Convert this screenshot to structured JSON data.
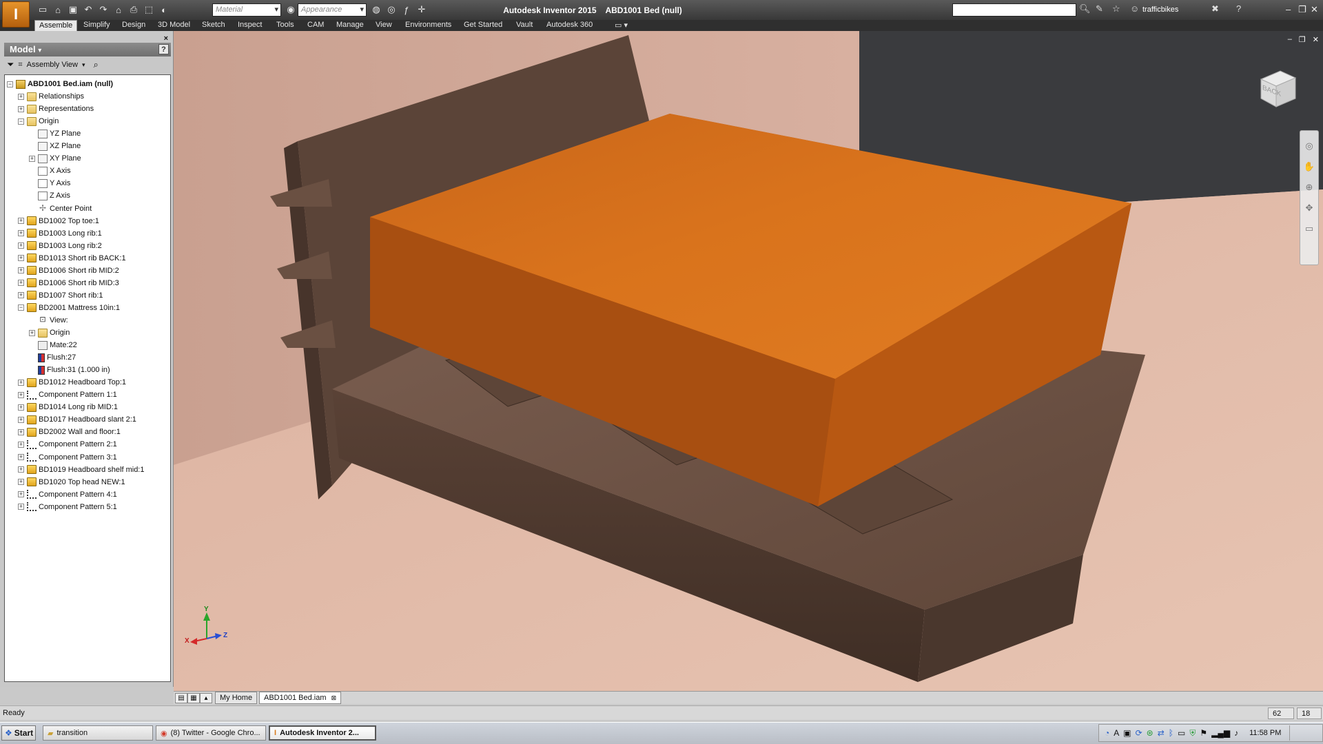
{
  "title_bar": {
    "app_title": "Autodesk Inventor 2015",
    "document_title": "ABD1001 Bed (null)",
    "material_placeholder": "Material",
    "appearance_placeholder": "Appearance",
    "user": "trafficbikes",
    "window_controls": [
      "–",
      "❐",
      "✕"
    ]
  },
  "ribbon": {
    "tabs": [
      "Assemble",
      "Simplify",
      "Design",
      "3D Model",
      "Sketch",
      "Inspect",
      "Tools",
      "CAM",
      "Manage",
      "View",
      "Environments",
      "Get Started",
      "Vault",
      "Autodesk 360"
    ],
    "active_tab": "Assemble"
  },
  "browser": {
    "title": "Model",
    "view_label": "Assembly View",
    "tree": [
      {
        "label": "ABD1001 Bed.iam (null)",
        "icon": "assembly-icon",
        "depth": 0,
        "expander": "−",
        "bold": true
      },
      {
        "label": "Relationships",
        "icon": "folder-icon",
        "depth": 1,
        "expander": "+"
      },
      {
        "label": "Representations",
        "icon": "folder-icon",
        "depth": 1,
        "expander": "+"
      },
      {
        "label": "Origin",
        "icon": "folder-icon",
        "depth": 1,
        "expander": "−"
      },
      {
        "label": "YZ Plane",
        "icon": "plane-icon",
        "depth": 2,
        "expander": ""
      },
      {
        "label": "XZ Plane",
        "icon": "plane-icon",
        "depth": 2,
        "expander": ""
      },
      {
        "label": "XY Plane",
        "icon": "plane-icon",
        "depth": 2,
        "expander": "+"
      },
      {
        "label": "X Axis",
        "icon": "axis-icon",
        "depth": 2,
        "expander": ""
      },
      {
        "label": "Y Axis",
        "icon": "axis-icon",
        "depth": 2,
        "expander": ""
      },
      {
        "label": "Z Axis",
        "icon": "axis-icon",
        "depth": 2,
        "expander": ""
      },
      {
        "label": "Center Point",
        "icon": "point-icon",
        "depth": 2,
        "expander": ""
      },
      {
        "label": "BD1002 Top toe:1",
        "icon": "part-icon",
        "depth": 1,
        "expander": "+"
      },
      {
        "label": "BD1003 Long rib:1",
        "icon": "part-icon",
        "depth": 1,
        "expander": "+"
      },
      {
        "label": "BD1003 Long rib:2",
        "icon": "part-icon",
        "depth": 1,
        "expander": "+"
      },
      {
        "label": "BD1013 Short rib BACK:1",
        "icon": "part-icon",
        "depth": 1,
        "expander": "+"
      },
      {
        "label": "BD1006 Short rib MID:2",
        "icon": "part-icon",
        "depth": 1,
        "expander": "+"
      },
      {
        "label": "BD1006 Short rib MID:3",
        "icon": "part-icon",
        "depth": 1,
        "expander": "+"
      },
      {
        "label": "BD1007 Short rib:1",
        "icon": "part-icon",
        "depth": 1,
        "expander": "+"
      },
      {
        "label": "BD2001 Mattress 10in:1",
        "icon": "part-icon",
        "depth": 1,
        "expander": "−"
      },
      {
        "label": "View:",
        "icon": "view-icon",
        "depth": 2,
        "expander": ""
      },
      {
        "label": "Origin",
        "icon": "folder-icon",
        "depth": 2,
        "expander": "+"
      },
      {
        "label": "Mate:22",
        "icon": "mate-icon",
        "depth": 2,
        "expander": ""
      },
      {
        "label": "Flush:27",
        "icon": "flush-icon",
        "depth": 2,
        "expander": ""
      },
      {
        "label": "Flush:31 (1.000 in)",
        "icon": "flush-icon",
        "depth": 2,
        "expander": ""
      },
      {
        "label": "BD1012 Headboard Top:1",
        "icon": "part-icon",
        "depth": 1,
        "expander": "+"
      },
      {
        "label": "Component Pattern 1:1",
        "icon": "pattern-icon",
        "depth": 1,
        "expander": "+"
      },
      {
        "label": "BD1014 Long rib MID:1",
        "icon": "part-icon",
        "depth": 1,
        "expander": "+"
      },
      {
        "label": "BD1017 Headboard slant 2:1",
        "icon": "part-icon",
        "depth": 1,
        "expander": "+"
      },
      {
        "label": "BD2002 Wall and floor:1",
        "icon": "part-icon",
        "depth": 1,
        "expander": "+"
      },
      {
        "label": "Component Pattern 2:1",
        "icon": "pattern-icon",
        "depth": 1,
        "expander": "+"
      },
      {
        "label": "Component Pattern 3:1",
        "icon": "pattern-icon",
        "depth": 1,
        "expander": "+"
      },
      {
        "label": "BD1019 Headboard shelf mid:1",
        "icon": "part-icon",
        "depth": 1,
        "expander": "+"
      },
      {
        "label": "BD1020 Top head NEW:1",
        "icon": "part-icon",
        "depth": 1,
        "expander": "+"
      },
      {
        "label": "Component Pattern 4:1",
        "icon": "pattern-icon",
        "depth": 1,
        "expander": "+"
      },
      {
        "label": "Component Pattern 5:1",
        "icon": "pattern-icon",
        "depth": 1,
        "expander": "+"
      }
    ]
  },
  "viewport": {
    "viewcube_face": "BACK",
    "axes": {
      "x": "X",
      "y": "Y",
      "z": "Z"
    },
    "colors": {
      "mattress": "#d9731c",
      "wood": "#6b5244",
      "floor": "#e2bca8",
      "wall_left": "#cfa898",
      "wall_dark": "#3a3b3e"
    }
  },
  "doc_tabs": {
    "tabs": [
      "My Home",
      "ABD1001 Bed.iam"
    ],
    "active": "ABD1001 Bed.iam"
  },
  "status_bar": {
    "text": "Ready",
    "count_a": "62",
    "count_b": "18"
  },
  "taskbar": {
    "start_label": "Start",
    "buttons": [
      "transition",
      "(8) Twitter - Google Chro...",
      "Autodesk Inventor 2..."
    ],
    "active": "Autodesk Inventor 2...",
    "clock": "11:58 PM"
  }
}
